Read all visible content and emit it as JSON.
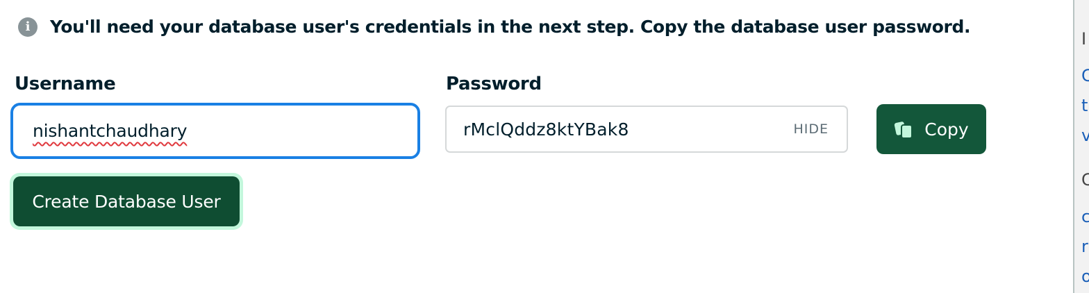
{
  "info_banner": {
    "icon": "info-icon",
    "text": "You'll need your database user's credentials in the next step. Copy the database user password."
  },
  "username": {
    "label": "Username",
    "value": "nishantchaudhary"
  },
  "password": {
    "label": "Password",
    "value": "rMclQddz8ktYBak8",
    "toggle_label": "HIDE"
  },
  "copy_button": {
    "label": "Copy",
    "icon": "copy-icon"
  },
  "create_button": {
    "label": "Create Database User"
  },
  "right_panel": {
    "fragments": [
      "I",
      "C",
      "t",
      "v",
      "C",
      "c",
      "r",
      "o"
    ]
  },
  "colors": {
    "primary_button": "#13573a",
    "create_button": "#0f4d32",
    "focus_ring": "#1a80e4",
    "create_ring": "#c3f7dc"
  }
}
